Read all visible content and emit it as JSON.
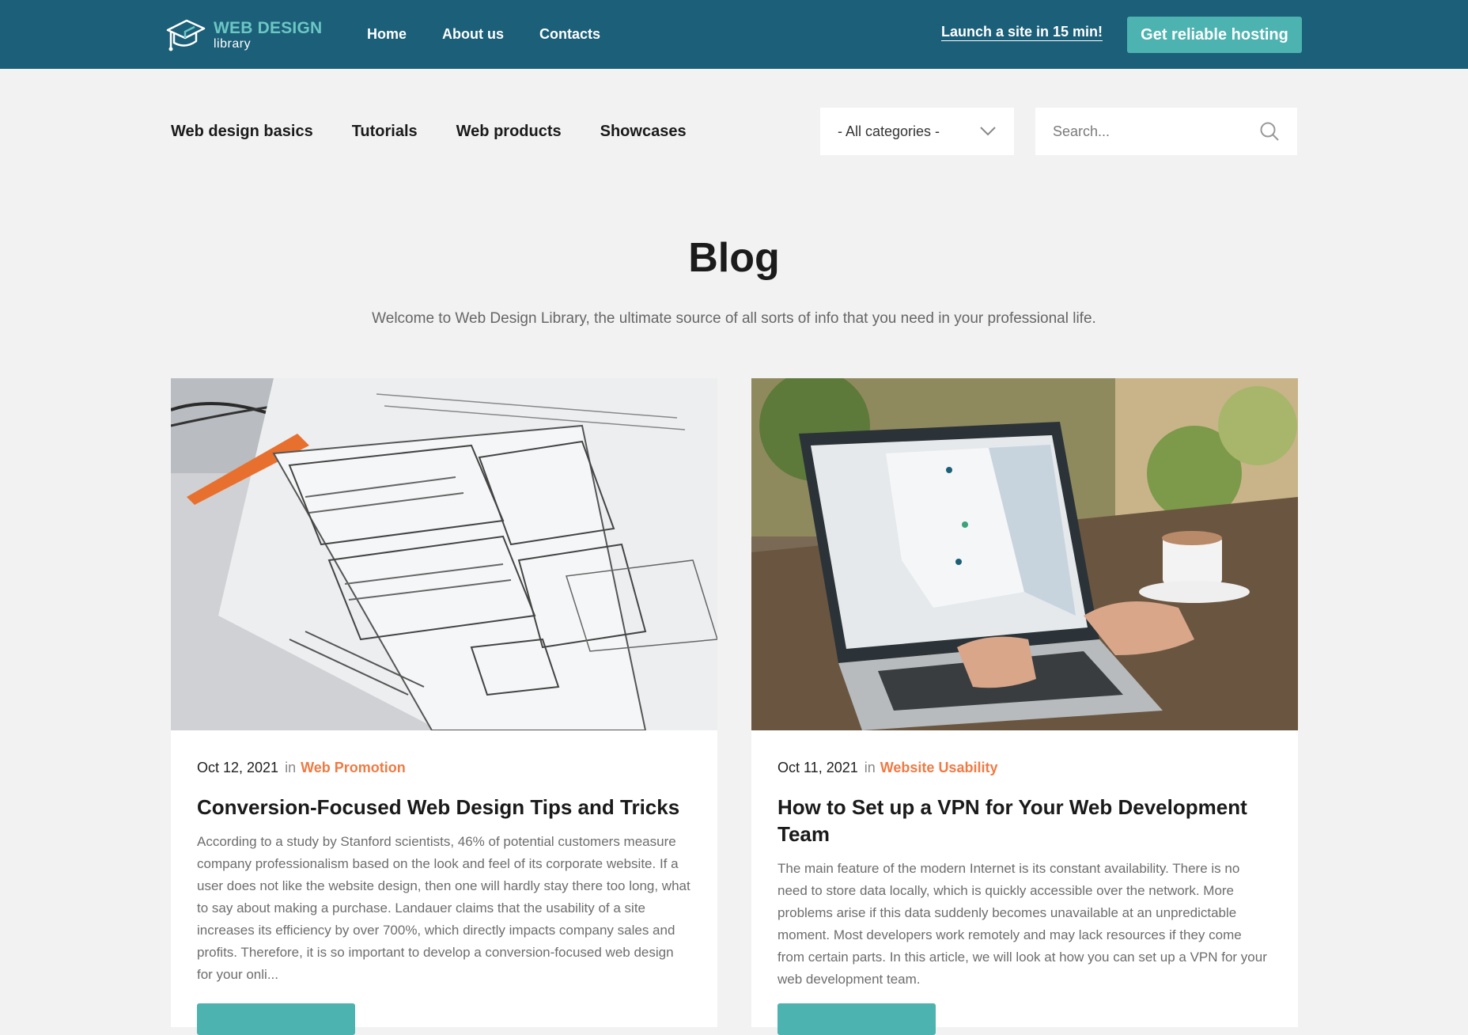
{
  "header": {
    "logo_title": "WEB DESIGN",
    "logo_sub": "library",
    "nav": [
      "Home",
      "About us",
      "Contacts"
    ],
    "launch_link": "Launch a site in 15 min!",
    "hosting_button": "Get reliable hosting"
  },
  "subnav": {
    "items": [
      "Web design basics",
      "Tutorials",
      "Web products",
      "Showcases"
    ],
    "category_select": "- All categories -",
    "search_placeholder": "Search..."
  },
  "page": {
    "title": "Blog",
    "intro": "Welcome to Web Design Library, the ultimate source of all sorts of info that you need in your professional life."
  },
  "posts": [
    {
      "date": "Oct 12, 2021",
      "in": "in",
      "category": "Web Promotion",
      "title": "Conversion-Focused Web Design Tips and Tricks",
      "excerpt": "According to a study by Stanford scientists, 46% of potential customers measure company professionalism based on the look and feel of its corporate website. If a user does not like the website design, then one will hardly stay there too long, what to say about making a purchase. Landauer claims that the usability of a site increases its efficiency by over 700%, which directly impacts company sales and profits. Therefore, it is so important to develop a conversion-focused web design for your onli..."
    },
    {
      "date": "Oct 11, 2021",
      "in": "in",
      "category": "Website Usability",
      "title": "How to Set up a VPN for Your Web Development Team",
      "excerpt": "The main feature of the modern Internet is its constant availability. There is no need to store data locally, which is quickly accessible over the network. More problems arise if this data suddenly becomes unavailable at an unpredictable moment. Most developers work remotely and may lack resources if they come from certain parts. In this article, we will look at how you can set up a VPN for your web development team."
    }
  ],
  "colors": {
    "topbar": "#1b5f78",
    "accent_teal": "#4db3b0",
    "category_orange": "#f07a43",
    "page_bg": "#f2f2f2"
  }
}
